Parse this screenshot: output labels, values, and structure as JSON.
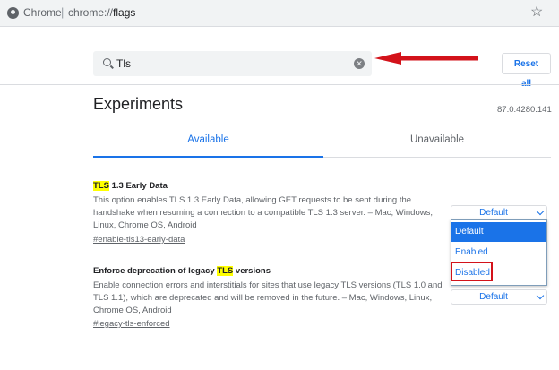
{
  "omnibox": {
    "brand": "Chrome",
    "separator": "|",
    "scheme": "chrome://",
    "host": "flags",
    "bookmark_icon": "star-icon"
  },
  "search": {
    "value": "Tls",
    "icon": "search-icon",
    "clear_icon": "clear-icon"
  },
  "reset_all_label": "Reset all",
  "page_title": "Experiments",
  "version": "87.0.4280.141",
  "tabs": [
    {
      "label": "Available",
      "active": true
    },
    {
      "label": "Unavailable",
      "active": false
    }
  ],
  "experiments": [
    {
      "title_highlight": "TLS",
      "title_rest": " 1.3 Early Data",
      "description": "This option enables TLS 1.3 Early Data, allowing GET requests to be sent during the handshake when resuming a connection to a compatible TLS 1.3 server. – Mac, Windows, Linux, Chrome OS, Android",
      "link": "#enable-tls13-early-data",
      "select_value": "Default"
    },
    {
      "title_before": "Enforce deprecation of legacy ",
      "title_highlight": "TLS",
      "title_after": " versions",
      "description": "Enable connection errors and interstitials for sites that use legacy TLS versions (TLS 1.0 and TLS 1.1), which are deprecated and will be removed in the future. – Mac, Windows, Linux, Chrome OS, Android",
      "link": "#legacy-tls-enforced",
      "select_value": "Default"
    }
  ],
  "dropdown_options": [
    {
      "label": "Default",
      "selected": true
    },
    {
      "label": "Enabled",
      "selected": false
    },
    {
      "label": "Disabled",
      "selected": false
    }
  ],
  "colors": {
    "accent": "#1a73e8",
    "highlight": "#ffff00",
    "annotation": "#d3121a"
  }
}
